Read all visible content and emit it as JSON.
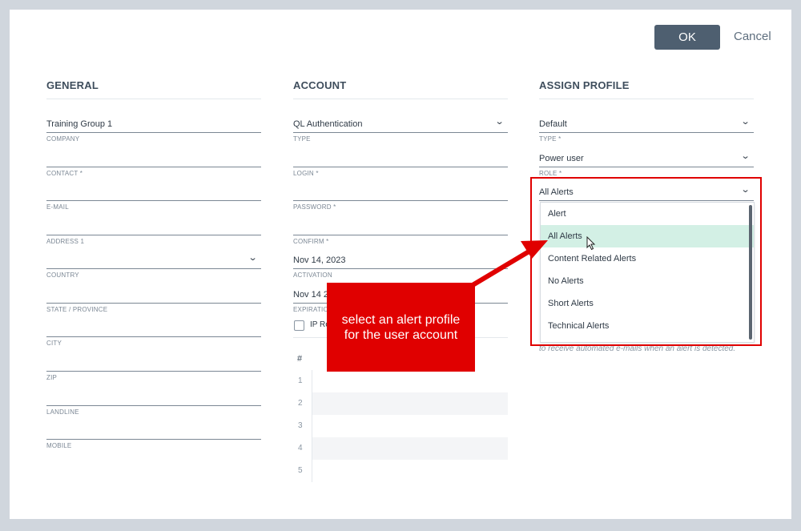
{
  "buttons": {
    "ok": "OK",
    "cancel": "Cancel"
  },
  "general": {
    "title": "GENERAL",
    "fields": [
      {
        "value": "Training Group 1",
        "label": "COMPANY"
      },
      {
        "value": "",
        "label": "CONTACT *"
      },
      {
        "value": "",
        "label": "E-MAIL"
      },
      {
        "value": "",
        "label": "ADDRESS 1"
      },
      {
        "value": "",
        "label": "COUNTRY"
      },
      {
        "value": "",
        "label": "STATE / PROVINCE"
      },
      {
        "value": "",
        "label": "CITY"
      },
      {
        "value": "",
        "label": "ZIP"
      },
      {
        "value": "",
        "label": "LANDLINE"
      },
      {
        "value": "",
        "label": "MOBILE"
      }
    ]
  },
  "account": {
    "title": "ACCOUNT",
    "fields": [
      {
        "value": "QL Authentication",
        "label": "TYPE"
      },
      {
        "value": "",
        "label": "LOGIN *"
      },
      {
        "value": "",
        "label": "PASSWORD *"
      },
      {
        "value": "",
        "label": "CONFIRM *"
      },
      {
        "value": "Nov 14, 2023",
        "label": "ACTIVATION"
      },
      {
        "value": "Nov 14 2",
        "label": "EXPIRATION"
      }
    ],
    "checkbox_label": "IP Re",
    "table_header": "#",
    "rows": [
      "1",
      "2",
      "3",
      "4",
      "5"
    ]
  },
  "assign_profile": {
    "title": "ASSIGN PROFILE",
    "fields": [
      {
        "value": "Default",
        "label": "TYPE *"
      },
      {
        "value": "Power user",
        "label": "ROLE *"
      },
      {
        "value": "All Alerts",
        "label": ""
      }
    ],
    "alert_options": [
      "Alert",
      "All Alerts",
      "Content Related Alerts",
      "No Alerts",
      "Short Alerts",
      "Technical Alerts"
    ],
    "selected_option": "All Alerts",
    "hint": "to receive automated e-mails when an alert is detected."
  },
  "callout": {
    "text": "select an alert profile for the user account"
  },
  "colors": {
    "accent": "#4e5f70",
    "highlight": "#e00000",
    "selection": "#d3f0e5"
  }
}
